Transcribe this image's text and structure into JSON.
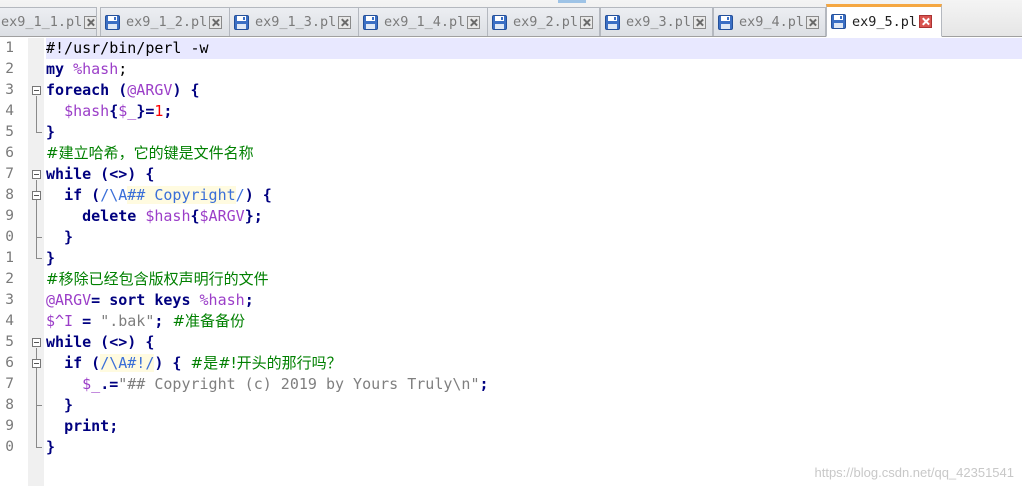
{
  "tabs": [
    {
      "label": "ex9_1_1.pl",
      "active": false,
      "icon": "floppy-disk-icon"
    },
    {
      "label": "ex9_1_2.pl",
      "active": false,
      "icon": "floppy-disk-icon"
    },
    {
      "label": "ex9_1_3.pl",
      "active": false,
      "icon": "floppy-disk-icon"
    },
    {
      "label": "ex9_1_4.pl",
      "active": false,
      "icon": "floppy-disk-icon"
    },
    {
      "label": "ex9_2.pl",
      "active": false,
      "icon": "floppy-disk-icon"
    },
    {
      "label": "ex9_3.pl",
      "active": false,
      "icon": "floppy-disk-icon"
    },
    {
      "label": "ex9_4.pl",
      "active": false,
      "icon": "floppy-disk-icon"
    },
    {
      "label": "ex9_5.pl",
      "active": true,
      "icon": "floppy-disk-icon"
    }
  ],
  "line_numbers": [
    "1",
    "2",
    "3",
    "4",
    "5",
    "6",
    "7",
    "8",
    "9",
    "0",
    "1",
    "2",
    "3",
    "4",
    "5",
    "6",
    "7",
    "8",
    "9",
    "0"
  ],
  "code": {
    "l1": "#!/usr/bin/perl -w",
    "l2_kw": "my",
    "l2_var": " %hash",
    "l2_end": ";",
    "l3_kw": "foreach",
    "l3_a": " (",
    "l3_var": "@ARGV",
    "l3_b": ") {",
    "l4_indent": "  ",
    "l4_var": "$hash",
    "l4_a": "{",
    "l4_var2": "$_",
    "l4_b": "}=",
    "l4_num": "1",
    "l4_end": ";",
    "l5": "}",
    "l6": "#建立哈希，它的键是文件名称",
    "l7_kw": "while",
    "l7_rest": " (<>) {",
    "l8_indent": "  ",
    "l8_kw": "if",
    "l8_a": " (",
    "l8_rx1": "/\\A",
    "l8_rx2": "## Copyright",
    "l8_rx3": "/",
    "l8_b": ") {",
    "l9_indent": "    ",
    "l9_kw": "delete",
    "l9_var": " $hash",
    "l9_a": "{",
    "l9_var2": "$ARGV",
    "l9_b": "};",
    "l10": "  }",
    "l11": "}",
    "l12": "#移除已经包含版权声明行的文件",
    "l13_var": "@ARGV",
    "l13_a": "= ",
    "l13_kw": "sort keys",
    "l13_var2": " %hash",
    "l13_end": ";",
    "l14_var": "$^I",
    "l14_a": " = ",
    "l14_str": "\".bak\"",
    "l14_b": "; ",
    "l14_cm": "#准备备份",
    "l15_kw": "while",
    "l15_rest": " (<>) {",
    "l16_indent": "  ",
    "l16_kw": "if",
    "l16_a": " (",
    "l16_rx": "/\\A#!/",
    "l16_b": ") { ",
    "l16_cm": "#是#!开头的那行吗？",
    "l17_indent": "    ",
    "l17_var": "$_",
    "l17_a": ".=",
    "l17_str": "\"## Copyright (c) 2019 by Yours Truly\\n\"",
    "l17_end": ";",
    "l18": "  }",
    "l19_indent": "  ",
    "l19_kw": "print",
    "l19_end": ";",
    "l20": "}"
  },
  "watermark": "https://blog.csdn.net/qq_42351541",
  "colors": {
    "keyword": "#00007f",
    "variable": "#9b3ec8",
    "comment": "#008000",
    "string": "#7f7f7f",
    "number": "#ff0000",
    "regex": "#3a6fd8",
    "current_line": "#e8e8ff",
    "active_tab_accent": "#f5a742"
  }
}
